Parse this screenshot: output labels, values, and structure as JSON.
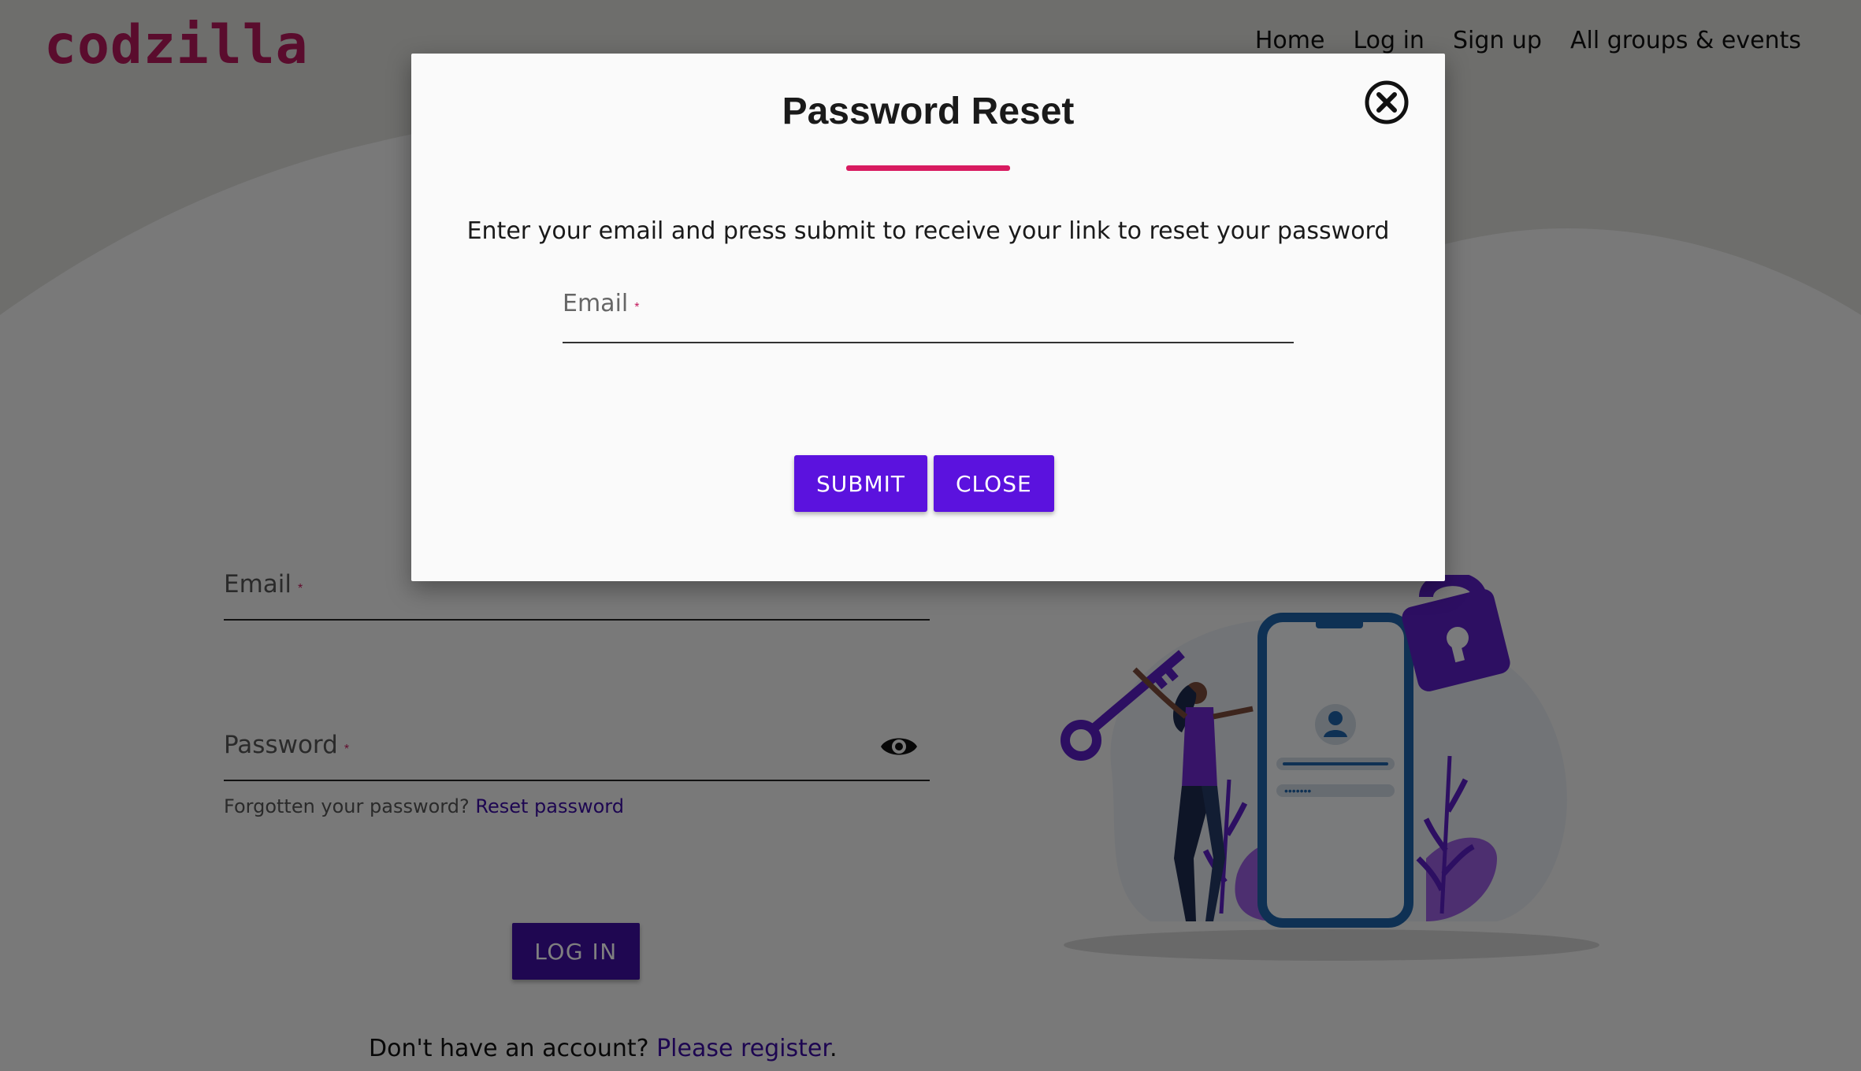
{
  "brand": {
    "logo_text": "codzilla",
    "logo_color": "#b5185a"
  },
  "nav": {
    "items": [
      "Home",
      "Log in",
      "Sign up",
      "All groups & events"
    ]
  },
  "login_form": {
    "email_label": "Email",
    "password_label": "Password",
    "required_mark": "*",
    "forgot_text": "Forgotten your password?",
    "reset_link": "Reset password",
    "login_button": "LOG IN",
    "register_text": "Don't have an account?",
    "register_link": "Please register",
    "register_suffix": "."
  },
  "modal": {
    "title": "Password Reset",
    "description": "Enter your email and press submit to receive your link to reset your password",
    "email_label": "Email",
    "required_mark": "*",
    "email_value": "",
    "submit_label": "SUBMIT",
    "close_label": "CLOSE",
    "close_icon": "close-circle-icon",
    "accent_color": "#d81b60",
    "button_color": "#5b12de"
  }
}
